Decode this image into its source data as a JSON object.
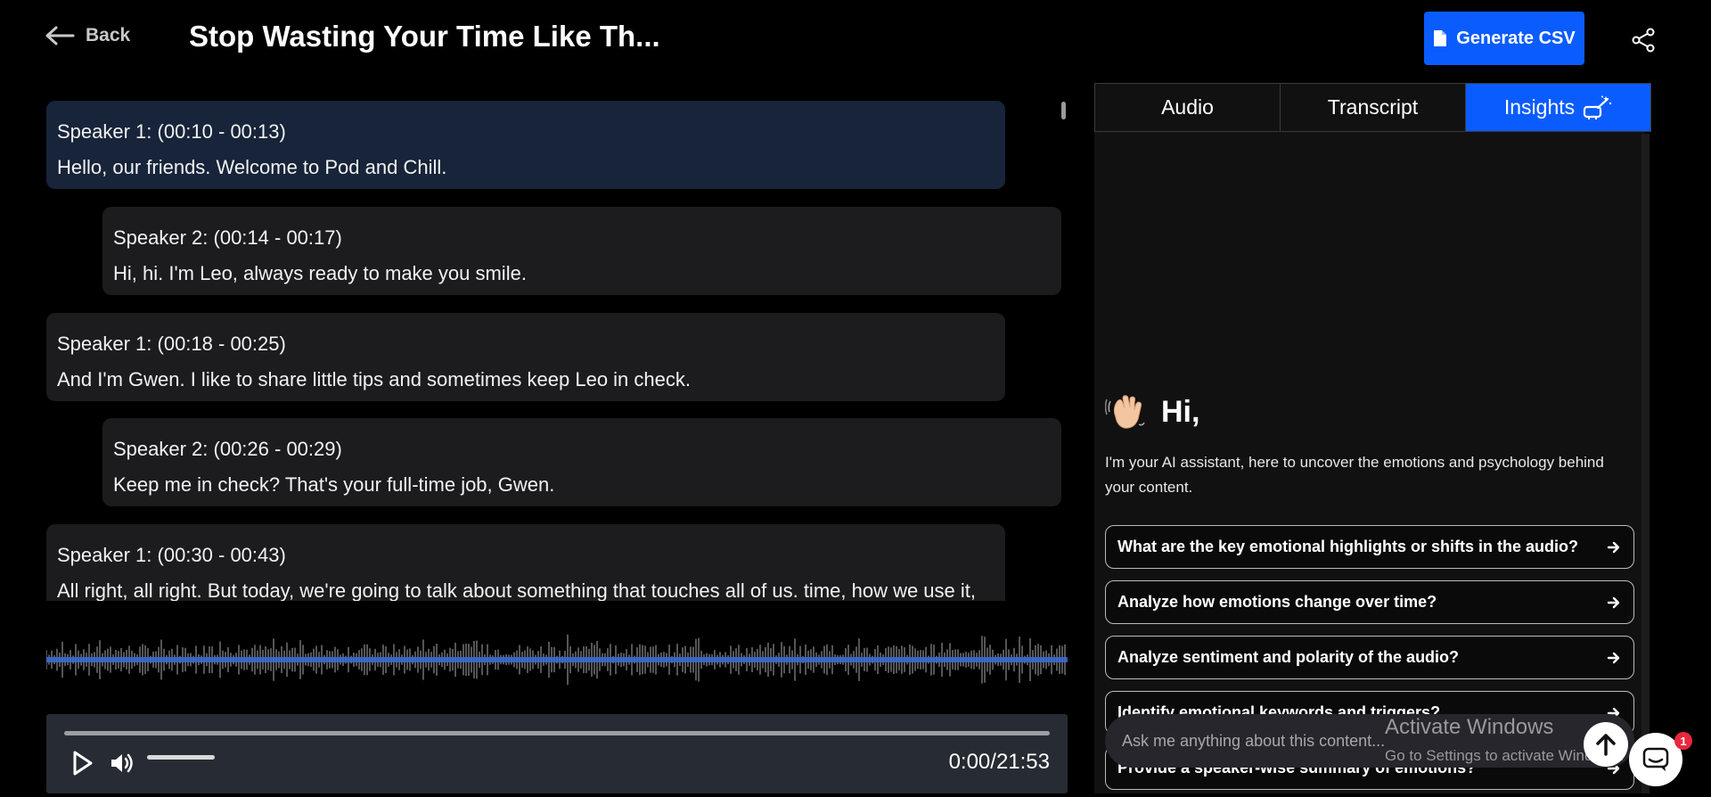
{
  "header": {
    "back_label": "Back",
    "title": "Stop Wasting Your Time Like Th...",
    "generate_label": "Generate CSV"
  },
  "transcript": [
    {
      "speaker": "Speaker 1: (00:10 - 00:13)",
      "text": "Hello, our friends. Welcome to Pod and Chill.",
      "active": true
    },
    {
      "speaker": "Speaker 2: (00:14 - 00:17)",
      "text": "Hi, hi. I'm Leo, always ready to make you smile.",
      "active": false
    },
    {
      "speaker": "Speaker 1: (00:18 - 00:25)",
      "text": "And I'm Gwen. I like to share little tips and sometimes keep Leo in check.",
      "active": false
    },
    {
      "speaker": "Speaker 2: (00:26 - 00:29)",
      "text": "Keep me in check? That's your full-time job, Gwen.",
      "active": false
    },
    {
      "speaker": "Speaker 1: (00:30 - 00:43)",
      "text": "All right, all right. But today, we're going to talk about something that touches all of us. time, how we use it,",
      "active": false
    }
  ],
  "player": {
    "time": "0:00/21:53",
    "progress": 0
  },
  "tabs": [
    {
      "label": "Audio",
      "active": false
    },
    {
      "label": "Transcript",
      "active": false
    },
    {
      "label": "Insights",
      "active": true
    }
  ],
  "insights": {
    "greeting": "Hi,",
    "intro": "I'm your AI assistant, here to uncover the emotions and psychology behind your content.",
    "questions": [
      "What are the key emotional highlights or shifts in the audio?",
      "Analyze how emotions change over time?",
      "Analyze sentiment and polarity of the audio?",
      "Identify emotional keywords and triggers?",
      "Provide a speaker-wise summary of emotions?"
    ],
    "ask_placeholder": "Ask me anything about this content..."
  },
  "watermark": {
    "line1": "Activate Windows",
    "line2": "Go to Settings to activate Windows."
  },
  "chat_badge": "1",
  "colors": {
    "accent": "#0b5cff",
    "active_entry": "#17243a",
    "entry_bg": "#1c1c1e",
    "waveform": "#3a6fd8"
  }
}
